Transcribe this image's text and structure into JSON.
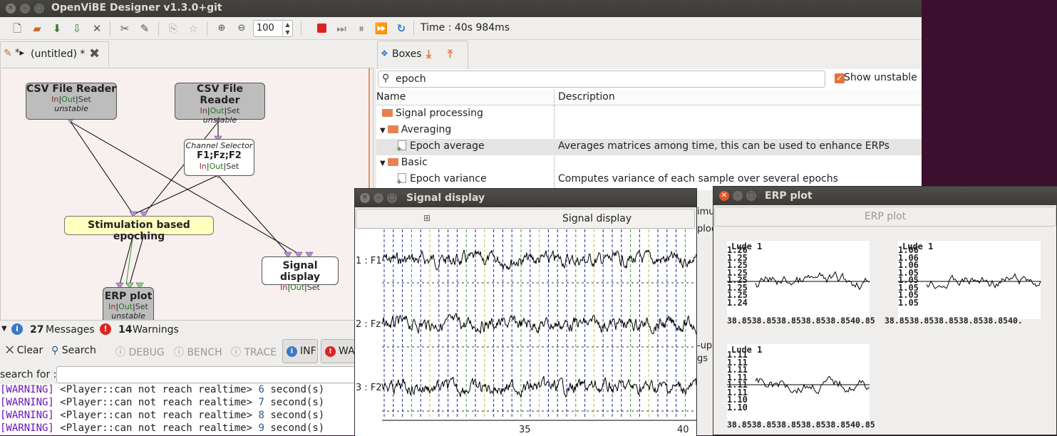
{
  "app": {
    "title": "OpenViBE Designer v1.3.0+git",
    "zoom_value": "100",
    "time_label": "Time : 40s 984ms"
  },
  "toolbar": {
    "icons": [
      "new-icon",
      "open-icon",
      "save-icon",
      "save-as-icon",
      "close-icon",
      "preferences-icon",
      "edit-icon",
      "undo-icon",
      "redo-icon",
      "zoom-in-icon",
      "zoom-out-icon",
      "stop-icon",
      "step-icon",
      "pause-icon",
      "play-icon",
      "fast-forward-icon"
    ]
  },
  "scenario": {
    "tab_label": "(untitled) *",
    "tab_prefix": "*▸",
    "boxes": {
      "csv1": {
        "name": "CSV File Reader",
        "in": "In",
        "out": "Out",
        "set": "Set",
        "status": "unstable"
      },
      "csv2": {
        "name": "CSV File Reader",
        "in": "In",
        "out": "Out",
        "set": "Set",
        "status": "unstable"
      },
      "chansel": {
        "label": "Channel Selector",
        "name": "F1;Fz;F2",
        "in": "In",
        "out": "Out",
        "set": "Set"
      },
      "stimep": {
        "name": "Stimulation based epoching"
      },
      "sigdisp": {
        "name": "Signal display",
        "in": "In",
        "out": "Out",
        "set": "Set"
      },
      "erpplot": {
        "name": "ERP plot",
        "in": "In",
        "out": "Out",
        "set": "Set",
        "status": "unstable"
      }
    }
  },
  "boxes_panel": {
    "tab_label": "Boxes",
    "search_value": "epoch",
    "show_unstable_label": "Show unstable",
    "col_name": "Name",
    "col_desc": "Description",
    "rows": [
      {
        "name": "Signal processing",
        "desc": "",
        "type": "folder"
      },
      {
        "name": "Averaging",
        "desc": "",
        "type": "folder"
      },
      {
        "name": "Epoch average",
        "desc": "Averages matrices among time, this can be used to enhance ERPs",
        "type": "box"
      },
      {
        "name": "Basic",
        "desc": "",
        "type": "folder"
      },
      {
        "name": "Epoch variance",
        "desc": "Computes variance of each sample over several epochs",
        "type": "box"
      }
    ],
    "partial_texts": [
      "imu",
      "ploc",
      "-up",
      "gs"
    ]
  },
  "console": {
    "messages_count": "27",
    "messages_label": "Messages",
    "warnings_count": "14",
    "warnings_label": "Warnings",
    "clear_label": "Clear",
    "search_label": "Search",
    "debug_label": "DEBUG",
    "bench_label": "BENCH",
    "trace_label": "TRACE",
    "info_label": "INF",
    "warn_label": "WA",
    "search_for_label": "search for :",
    "lines": [
      {
        "tag": "[WARNING]",
        "text": "<Player::can not reach realtime>",
        "num": "6",
        "unit": "second(s)"
      },
      {
        "tag": "[WARNING]",
        "text": "<Player::can not reach realtime>",
        "num": "7",
        "unit": "second(s)"
      },
      {
        "tag": "[WARNING]",
        "text": "<Player::can not reach realtime>",
        "num": "8",
        "unit": "second(s)"
      },
      {
        "tag": "[WARNING]",
        "text": "<Player::can not reach realtime>",
        "num": "9",
        "unit": "second(s)"
      }
    ]
  },
  "signal_window": {
    "title": "Signal display",
    "button_label": "Signal display",
    "channels": [
      "1 : F1",
      "2 : Fz",
      "3 : F2"
    ],
    "x_ticks": [
      "35",
      "40"
    ]
  },
  "erp_window": {
    "title": "ERP plot",
    "button_label": "ERP plot",
    "plots": [
      {
        "title": "Lude 1",
        "y_ticks": [
          "1.26",
          "1.25",
          "1.25",
          "1.25",
          "1.25",
          "1.25",
          "1.25",
          "1.24"
        ],
        "x_ticks": "38.8538.8538.8538.8538.8540.85"
      },
      {
        "title": "Lude 1",
        "y_ticks": [
          "1.06",
          "1.06",
          "1.06",
          "1.05",
          "1.05",
          "1.05",
          "1.05",
          "1.05"
        ],
        "x_ticks": "38.8538.8538.8538.8538.8540."
      },
      {
        "title": "Lude 1",
        "y_ticks": [
          "1.11",
          "1.11",
          "1.11",
          "1.11",
          "1.11",
          "1.11",
          "1.10",
          "1.10"
        ],
        "x_ticks": "38.8538.8538.8538.8538.8540.85"
      }
    ]
  },
  "colors": {
    "accent": "#e4733a",
    "warning_tag": "#6a13b8",
    "scenario_bg": "#f8efef",
    "stim_box": "#ffffc0"
  }
}
